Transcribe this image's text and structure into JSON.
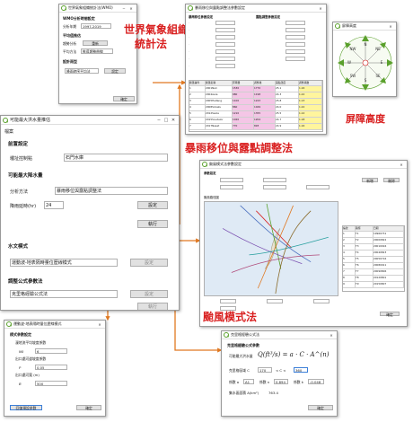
{
  "callouts": {
    "wmo": "世界氣象組織",
    "wmo2": "統計法",
    "storm_shift": "暴雨移位與露點調整法",
    "barrier": "屏障高度",
    "typhoon": "颱風模式法"
  },
  "main_window": {
    "title": "可能最大洪水量推估",
    "menu": "檔案",
    "sec_pre": "前置設定",
    "basin_label": "壩址控制點",
    "basin_value": "石門水庫",
    "sec_pmp": "可能最大降水量",
    "method_label": "分析方法",
    "method_value": "暴雨移位與露點調整法",
    "duration_label": "降雨延時(hr)",
    "duration_value": "24",
    "settings_btn": "設定",
    "execute_btn": "執行",
    "sec_hydro": "水文模式",
    "hydro_value": "運動波-地表隔時量位歷線模式",
    "sec_peak": "調整公式參數法",
    "peak_value": "克里格經驗公式法",
    "settings_btn2": "設定",
    "settings_btn3": "設定",
    "execute_btn2": "執行"
  },
  "wmo_window": {
    "title": "世界氣象組織統計法(WMO)",
    "header": "WMO分析時間設定",
    "range_label": "分析年期",
    "range_value": "1997-2019",
    "sec_avg": "平均值推估",
    "trend_label": "趨勢分析",
    "trend_btn": "重新",
    "method_label": "平均方法",
    "method_value": "推導趨勢曲線",
    "sec_design": "設計雨型",
    "design_value": "降雨時序平均法",
    "design_btn": "設定",
    "ok_btn": "確定"
  },
  "storm_window": {
    "title": "暴雨移位與露點調整法參數設定",
    "header_left": "暴雨移位參數設定",
    "header_right": "露點調整參數設定",
    "table_headers": [
      "颱風事件",
      "颱風名稱",
      "原雨量",
      "調整後",
      "露點溫度",
      "調整係數"
    ],
    "rows": [
      [
        "1",
        "2001Nari",
        "1530",
        "1770",
        "25.1",
        "1.16"
      ],
      [
        "2",
        "2004Aere",
        "980",
        "1198",
        "24.3",
        "1.22"
      ],
      [
        "3",
        "2005Haitang",
        "1100",
        "1243",
        "25.8",
        "1.13"
      ],
      [
        "4",
        "2008Sinlaku",
        "860",
        "1049",
        "24.0",
        "1.22"
      ],
      [
        "5",
        "2012Saola",
        "1210",
        "1355",
        "25.5",
        "1.12"
      ],
      [
        "6",
        "2015Soudelor",
        "1020",
        "1204",
        "24.7",
        "1.18"
      ],
      [
        "7",
        "2017Nesat",
        "770",
        "893",
        "24.9",
        "1.16"
      ]
    ]
  },
  "barrier_window": {
    "title": "屏障高度",
    "directions": [
      "N",
      "NE",
      "E",
      "SE",
      "S",
      "SW",
      "W",
      "NW"
    ]
  },
  "typhoon_window": {
    "title": "颱風模式法參數設定",
    "sec_params": "參數設定",
    "lat_label": "颱風路徑",
    "btn_add": "新增",
    "btn_del": "刪除",
    "map_label": "颱風路徑圖",
    "list_headers": [
      "編號",
      "路徑",
      "日期"
    ],
    "list_rows": [
      [
        "1",
        "T1",
        "19960731"
      ],
      [
        "2",
        "T2",
        "20000822"
      ],
      [
        "3",
        "T3",
        "20010916"
      ],
      [
        "4",
        "T4",
        "20040823"
      ],
      [
        "5",
        "T5",
        "20050716"
      ],
      [
        "6",
        "T6",
        "20080911"
      ],
      [
        "7",
        "T7",
        "20090806"
      ],
      [
        "8",
        "T8",
        "20120801"
      ],
      [
        "9",
        "T9",
        "20150807"
      ]
    ],
    "ok_btn": "確定"
  },
  "hydro_window": {
    "title": "運動波-地表隔時量位歷線模式",
    "header": "模式參數設定",
    "param1_label": "漫地流平均坡度係數",
    "n0_label": "N0",
    "n0_value": "6",
    "param2_label": "出口處河道坡度係數",
    "p_label": "P",
    "p_value": "0.05",
    "param3_label": "出口處河寬 (m)",
    "b_label": "B",
    "b_value": "500",
    "btn_restore": "回復預設參數",
    "btn_ok": "確定"
  },
  "peak_window": {
    "title": "克里格經驗公式法",
    "header": "克里格經驗公式參數",
    "formula_label": "可能最大洪水量",
    "formula": "Q(ft³/s) = a · C · A^(n)",
    "range_label": "克里格區域 C",
    "c_min": "170",
    "c_max": "360",
    "a_label": "係數 a",
    "a_value": "A1",
    "n_label": "係數 n",
    "n_value": "0.894",
    "k_label": "係數 k",
    "k_value": "-0.048",
    "area_label": "集水區面積 A(km²)",
    "area_value": "763.4",
    "ok_btn": "確定"
  },
  "colors": {
    "accent_red": "#d92020",
    "arrow_orange": "#e07820",
    "qgis_green": "#5aa02c",
    "highlight_pink": "#f4c6e6",
    "highlight_yellow": "#fff59d"
  }
}
